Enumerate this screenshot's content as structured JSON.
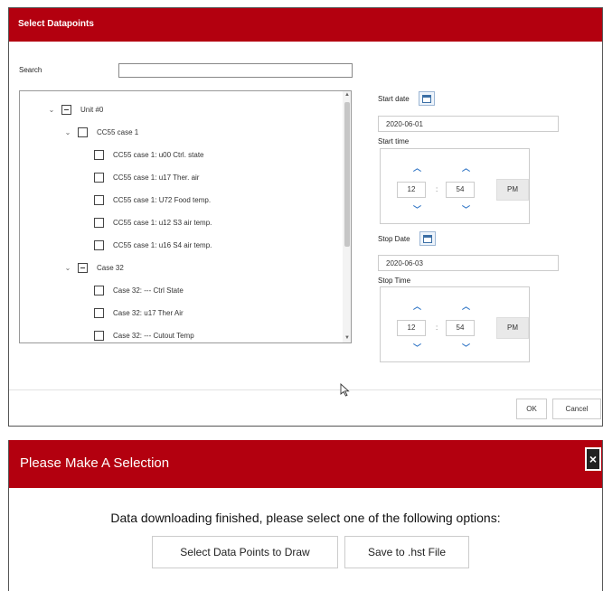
{
  "dialog1": {
    "title": "Select Datapoints",
    "search_label": "Search",
    "search_value": "",
    "tree": [
      {
        "label": "Unit #0",
        "depth": 0,
        "expandable": true,
        "state": "partial"
      },
      {
        "label": "CC55 case 1",
        "depth": 1,
        "expandable": true,
        "state": "unchecked"
      },
      {
        "label": "CC55 case 1: u00 Ctrl. state",
        "depth": 2,
        "expandable": false,
        "state": "unchecked"
      },
      {
        "label": "CC55 case 1: u17 Ther. air",
        "depth": 2,
        "expandable": false,
        "state": "unchecked"
      },
      {
        "label": "CC55 case 1: U72 Food temp.",
        "depth": 2,
        "expandable": false,
        "state": "unchecked"
      },
      {
        "label": "CC55 case 1: u12 S3 air temp.",
        "depth": 2,
        "expandable": false,
        "state": "unchecked"
      },
      {
        "label": "CC55 case 1: u16 S4 air temp.",
        "depth": 2,
        "expandable": false,
        "state": "unchecked"
      },
      {
        "label": "Case 32",
        "depth": 1,
        "expandable": true,
        "state": "partial"
      },
      {
        "label": "Case 32: --- Ctrl State",
        "depth": 2,
        "expandable": false,
        "state": "unchecked"
      },
      {
        "label": "Case 32: u17 Ther Air",
        "depth": 2,
        "expandable": false,
        "state": "unchecked"
      },
      {
        "label": "Case 32: --- Cutout Temp",
        "depth": 2,
        "expandable": false,
        "state": "unchecked"
      }
    ],
    "start_date_label": "Start date",
    "start_date": "2020-06-01",
    "start_time_label": "Start time",
    "start_hour": "12",
    "start_minute": "54",
    "start_ampm": "PM",
    "stop_date_label": "Stop Date",
    "stop_date": "2020-06-03",
    "stop_time_label": "Stop Time",
    "stop_hour": "12",
    "stop_minute": "54",
    "stop_ampm": "PM",
    "time_separator": ":",
    "ok_label": "OK",
    "cancel_label": "Cancel"
  },
  "dialog2": {
    "title": "Please Make A Selection",
    "close_glyph": "×",
    "message": "Data downloading finished, please select one of the following options:",
    "btn_draw": "Select Data Points to Draw",
    "btn_save": "Save to .hst File"
  },
  "colors": {
    "header_red": "#b3000f",
    "spinner_blue": "#2b72c4"
  }
}
